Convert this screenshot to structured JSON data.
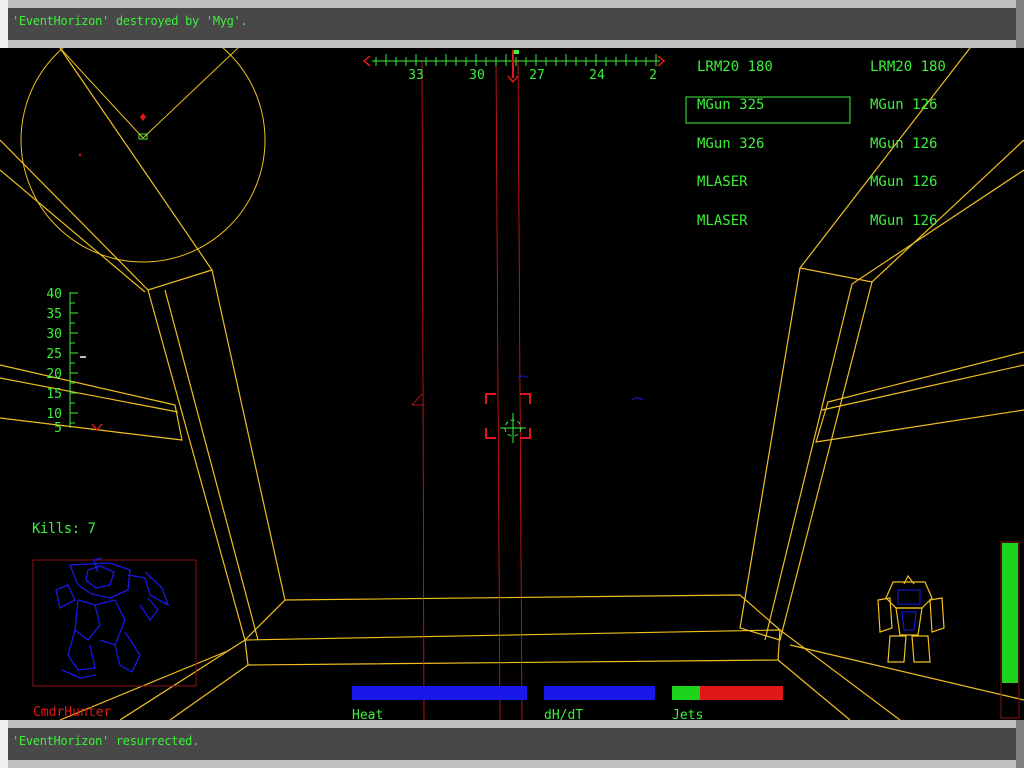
{
  "messages": {
    "top": "'EventHorizon' destroyed by 'Myg'.",
    "bottom": "'EventHorizon' resurrected."
  },
  "compass": {
    "labels": [
      "33",
      "30",
      "27",
      "24",
      "2"
    ]
  },
  "weapons": {
    "left": [
      "LRM20 180",
      "MGun 325",
      "MGun 326",
      "MLASER",
      "MLASER"
    ],
    "right": [
      "LRM20 180",
      "MGun 126",
      "MGun 126",
      "MGun 126",
      "MGun 126"
    ],
    "selected_index": 1
  },
  "throttle": {
    "labels": [
      "40",
      "35",
      "30",
      "25",
      "20",
      "15",
      "10",
      "5"
    ]
  },
  "kills": "Kills: 7",
  "target": {
    "name": "CmdrHunter"
  },
  "gauges": {
    "heat_label": "Heat",
    "dhdt_label": "dH/dT",
    "jets_label": "Jets",
    "jets_fraction": 0.25
  },
  "colors": {
    "hud_green": "#3cf03c",
    "frame_yellow": "#f0c020",
    "hud_red": "#e01818",
    "hud_blue": "#1818e8"
  }
}
